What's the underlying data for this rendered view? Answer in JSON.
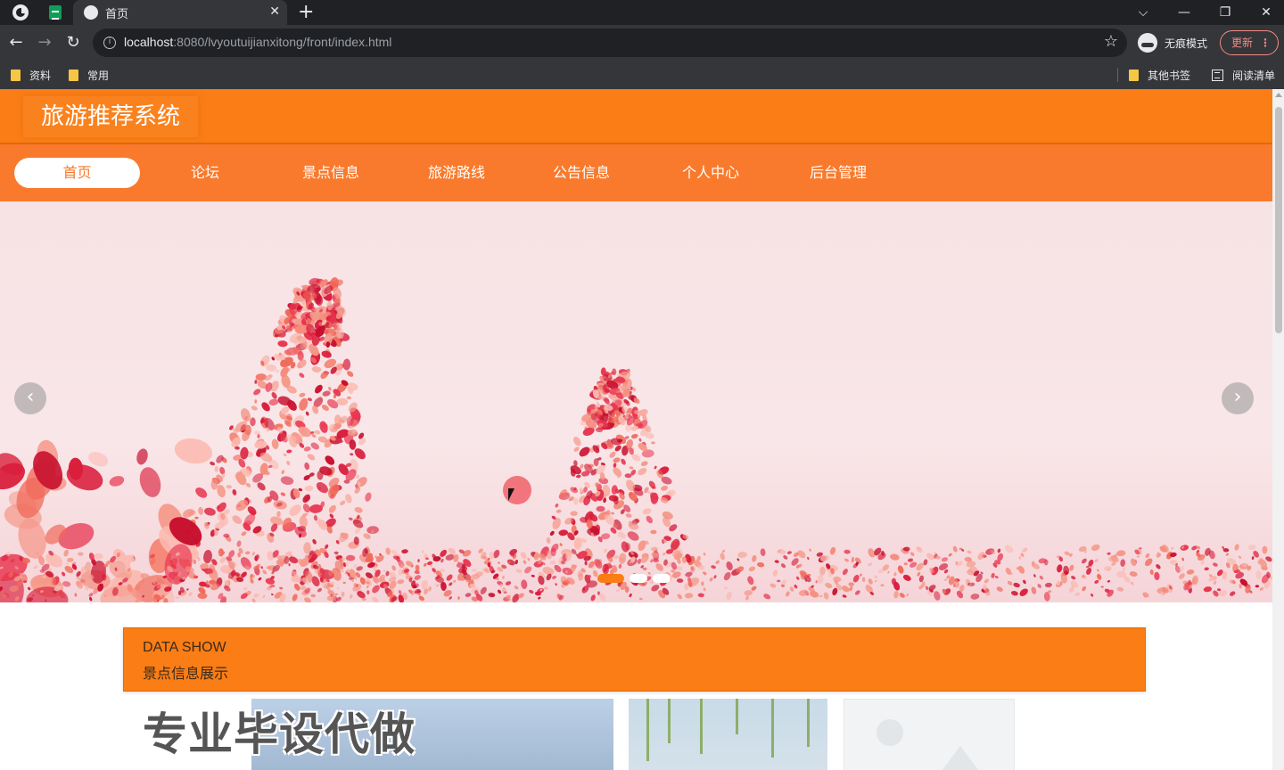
{
  "browser": {
    "tab_title": "首页",
    "new_tab_symbol": "+",
    "url_host": "localhost",
    "url_rest": ":8080/lvyoutuijianxitong/front/index.html",
    "incognito_label": "无痕模式",
    "update_label": "更新",
    "window_controls": {
      "dropdown": "⌵",
      "minimize": "—",
      "restore": "❐",
      "close": "✕"
    },
    "bookmarks": [
      "资料",
      "常用"
    ],
    "bookmarks_right": {
      "other": "其他书签",
      "reading_list": "阅读清单"
    }
  },
  "site": {
    "title": "旅游推荐系统",
    "nav": [
      {
        "label": "首页",
        "active": true
      },
      {
        "label": "论坛"
      },
      {
        "label": "景点信息"
      },
      {
        "label": "旅游路线"
      },
      {
        "label": "公告信息"
      },
      {
        "label": "个人中心"
      },
      {
        "label": "后台管理"
      }
    ],
    "banner": {
      "prev_symbol": "‹",
      "next_symbol": "›",
      "slides": 3,
      "active_slide": 1
    },
    "section": {
      "title_en": "DATA SHOW",
      "title_cn": "景点信息展示"
    },
    "watermark": "专业毕设代做"
  },
  "colors": {
    "brand_orange": "#fa7d15",
    "nav_orange": "#f97a2c",
    "petal_red": "#e8354f"
  }
}
